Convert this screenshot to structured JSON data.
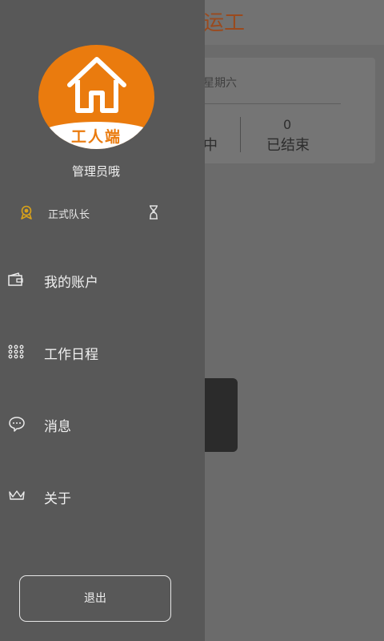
{
  "background": {
    "title": "运工",
    "date": "星期六",
    "stats": {
      "left_label": "中",
      "right_value": "0",
      "right_label": "已结束"
    }
  },
  "drawer": {
    "avatar_text": "工人端",
    "user_name": "管理员哦",
    "rank": "正式队长",
    "menu": [
      {
        "label": "我的账户",
        "icon": "wallet-icon"
      },
      {
        "label": "工作日程",
        "icon": "grid-dots-icon"
      },
      {
        "label": "消息",
        "icon": "chat-icon"
      },
      {
        "label": "关于",
        "icon": "crown-icon"
      }
    ],
    "logout_label": "退出"
  },
  "colors": {
    "brand": "#EA7B0E",
    "drawer_bg": "#585858",
    "medal": "#D9A21A"
  }
}
